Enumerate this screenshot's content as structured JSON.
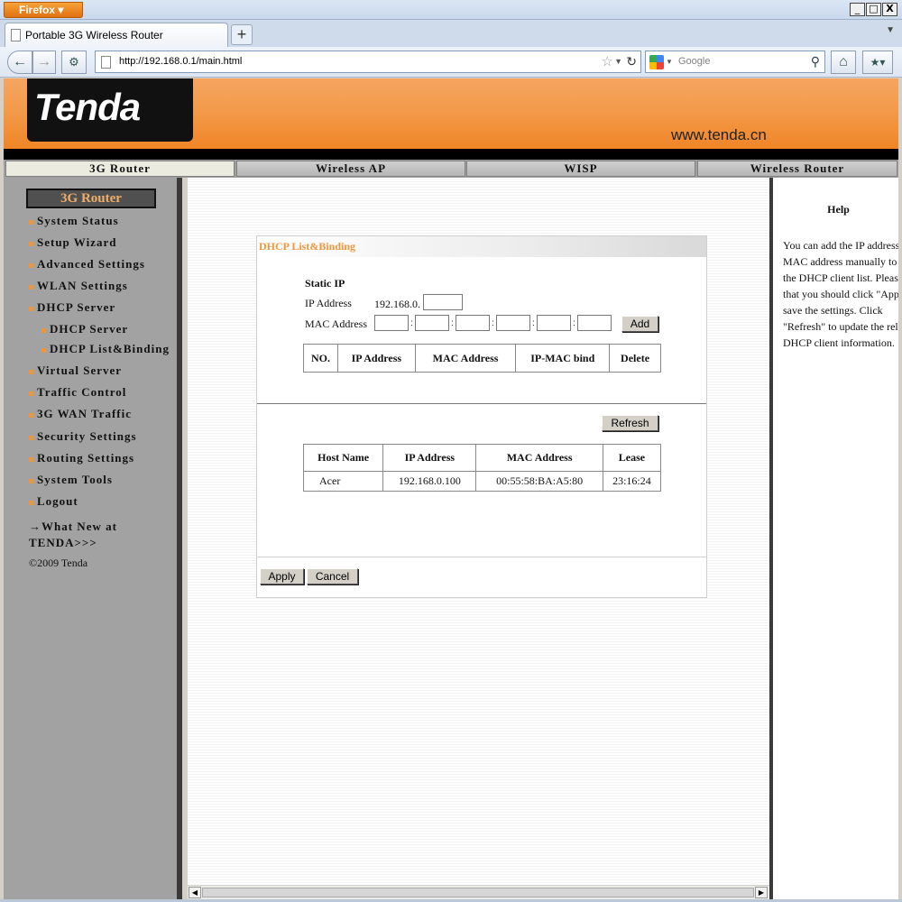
{
  "browser": {
    "app_button": "Firefox",
    "tab_title": "Portable 3G Wireless Router",
    "url": "http://192.168.0.1/main.html",
    "search_placeholder": "Google",
    "win_min": "_",
    "win_max": "□",
    "win_close": "X"
  },
  "header": {
    "logo": "Tenda",
    "site_url": "www.tenda.cn"
  },
  "modes": [
    "3G Router",
    "Wireless AP",
    "WISP",
    "Wireless Router"
  ],
  "sidebar": {
    "title": "3G Router",
    "items": [
      "System Status",
      "Setup Wizard",
      "Advanced Settings",
      "WLAN Settings",
      "DHCP Server",
      "Virtual Server",
      "Traffic Control",
      "3G WAN Traffic",
      "Security Settings",
      "Routing Settings",
      "System Tools",
      "Logout"
    ],
    "subitems": [
      "DHCP Server",
      "DHCP List&Binding"
    ],
    "whats_new": "→What New at TENDA>>>",
    "copyright": "©2009 Tenda"
  },
  "panel": {
    "title": "DHCP List&Binding",
    "static_ip_label": "Static IP",
    "ip_label": "IP Address",
    "ip_prefix": "192.168.0.",
    "mac_label": "MAC Address",
    "mac_sep": ":",
    "add_button": "Add",
    "bind_table_headers": [
      "NO.",
      "IP Address",
      "MAC Address",
      "IP-MAC bind",
      "Delete"
    ],
    "refresh_button": "Refresh",
    "client_table_headers": [
      "Host Name",
      "IP Address",
      "MAC Address",
      "Lease"
    ],
    "client_rows": [
      [
        "Acer",
        "192.168.0.100",
        "00:55:58:BA:A5:80",
        "23:16:24"
      ]
    ],
    "apply_button": "Apply",
    "cancel_button": "Cancel"
  },
  "help": {
    "title": "Help",
    "text": "You can add the IP address and MAC address manually to set the DHCP client list. Please note that you should click \"Apply\" to save the settings. Click \"Refresh\" to update the related DHCP client information."
  }
}
